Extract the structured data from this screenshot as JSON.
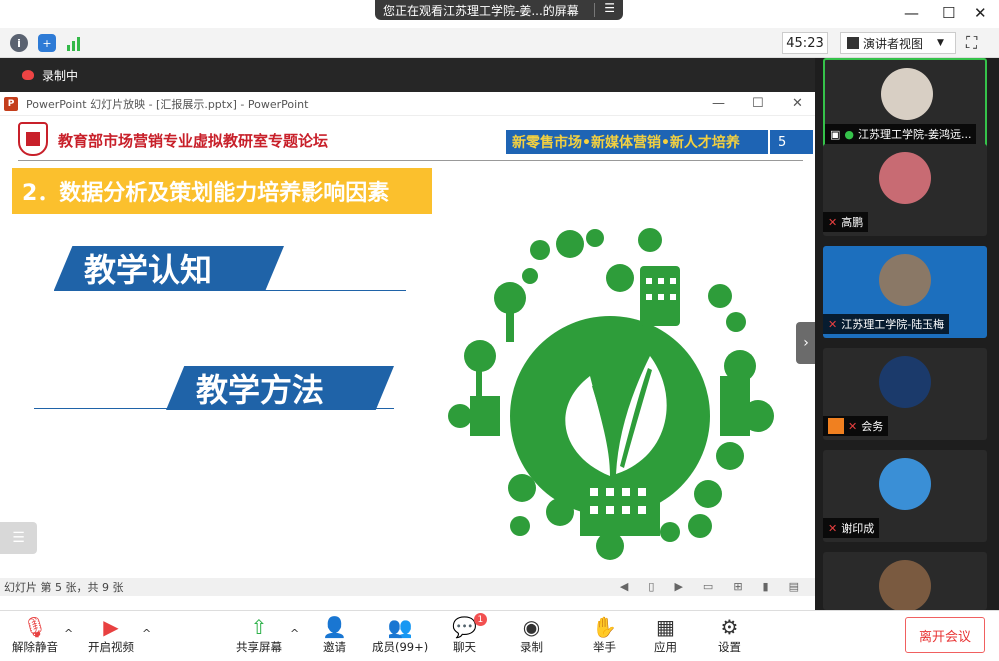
{
  "top_banner": {
    "text": "您正在观看江苏理工学院-姜...的屏幕",
    "menu_icon": "menu-icon"
  },
  "window_controls": {
    "minimize": "—",
    "maximize": "☐",
    "close": "✕"
  },
  "toolbar": {
    "timer": "45:23",
    "view_mode": "演讲者视图",
    "icons": [
      "info-icon",
      "shield-icon",
      "signal-icon"
    ]
  },
  "recording": {
    "label": "录制中"
  },
  "ppt": {
    "window_title": "PowerPoint 幻灯片放映 - [汇报展示.pptx] - PowerPoint",
    "status": "幻灯片 第 5 张，共 9 张"
  },
  "slide": {
    "header_title": "教育部市场营销专业虚拟教研室专题论坛",
    "banner": "新零售市场•新媒体营销•新人才培养",
    "number": "5",
    "section_title": "2．数据分析及策划能力培养影响因素",
    "tag1": "教学认知",
    "tag2": "教学方法",
    "colors": {
      "green": "#2e9d3a",
      "blue": "#1f63a8",
      "yellow": "#fbc02d",
      "red": "#c8202a"
    }
  },
  "participants": [
    {
      "name": "江苏理工学院-姜鸿远...",
      "muted": false,
      "sharing": true
    },
    {
      "name": "高鹏",
      "muted": true
    },
    {
      "name": "江苏理工学院-陆玉梅",
      "muted": true
    },
    {
      "name": "会务",
      "muted": true
    },
    {
      "name": "谢印成",
      "muted": true
    }
  ],
  "bottom_bar": {
    "unmute": "解除静音",
    "start_video": "开启视频",
    "share_screen": "共享屏幕",
    "invite": "邀请",
    "members": "成员(99+)",
    "chat": "聊天",
    "chat_badge": "1",
    "record": "录制",
    "raise_hand": "举手",
    "apps": "应用",
    "settings": "设置",
    "leave": "离开会议"
  }
}
